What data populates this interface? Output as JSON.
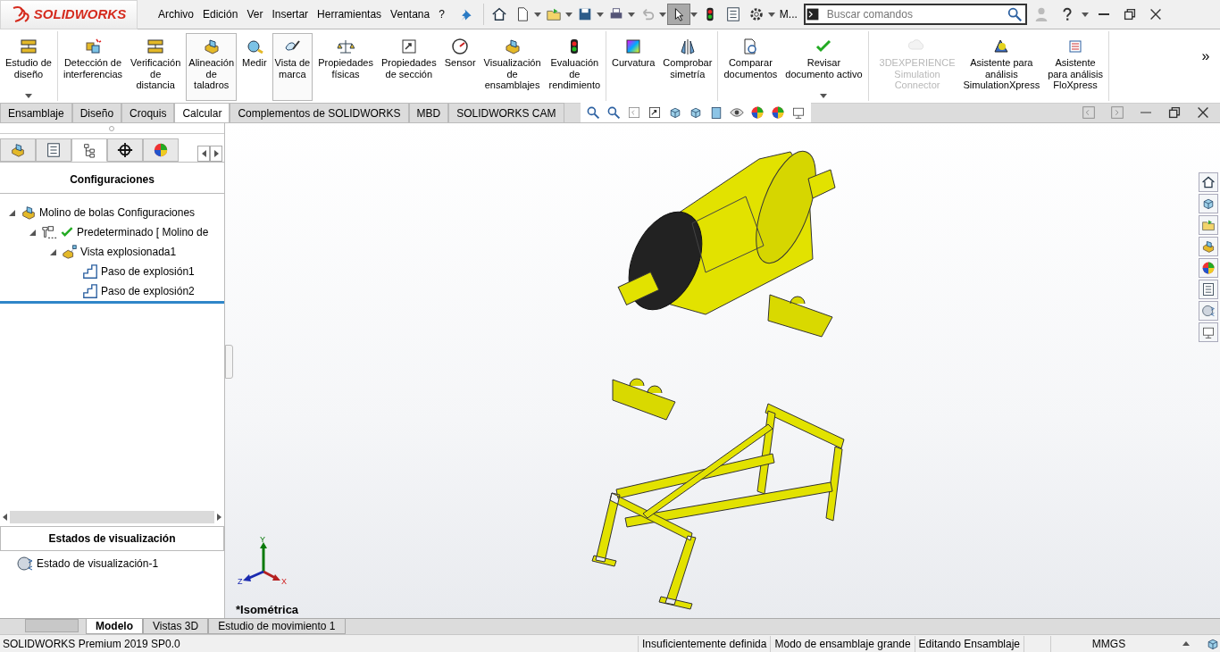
{
  "app": {
    "logo": "SOLIDWORKS"
  },
  "menu": [
    "Archivo",
    "Edición",
    "Ver",
    "Insertar",
    "Herramientas",
    "Ventana",
    "?"
  ],
  "quick_toolbar": {
    "overflow_label": "M...",
    "select_pressed": true,
    "undo_disabled": true
  },
  "search": {
    "placeholder": "Buscar comandos"
  },
  "ribbon": {
    "groups": [
      [
        {
          "label": "Estudio de\ndiseño",
          "selected": false,
          "disabled": false,
          "dropdown": true
        }
      ],
      [
        {
          "label": "Detección de\ninterferencias",
          "selected": false,
          "disabled": false,
          "dropdown": false
        },
        {
          "label": "Verificación\nde\ndistancia",
          "selected": false,
          "disabled": false,
          "dropdown": false
        },
        {
          "label": "Alineación\nde\ntaladros",
          "selected": true,
          "disabled": false,
          "dropdown": false
        },
        {
          "label": "Medir",
          "selected": false,
          "disabled": false,
          "dropdown": false
        },
        {
          "label": "Vista de\nmarca",
          "selected": true,
          "disabled": false,
          "dropdown": false
        },
        {
          "label": "Propiedades\nfísicas",
          "selected": false,
          "disabled": false,
          "dropdown": false
        },
        {
          "label": "Propiedades\nde sección",
          "selected": false,
          "disabled": false,
          "dropdown": false
        },
        {
          "label": "Sensor",
          "selected": false,
          "disabled": false,
          "dropdown": false
        },
        {
          "label": "Visualización\nde\nensamblajes",
          "selected": false,
          "disabled": false,
          "dropdown": false
        },
        {
          "label": "Evaluación\nde\nrendimiento",
          "selected": false,
          "disabled": false,
          "dropdown": false
        }
      ],
      [
        {
          "label": "Curvatura",
          "selected": false,
          "disabled": false,
          "dropdown": false
        },
        {
          "label": "Comprobar\nsimetría",
          "selected": false,
          "disabled": false,
          "dropdown": false
        }
      ],
      [
        {
          "label": "Comparar\ndocumentos",
          "selected": false,
          "disabled": false,
          "dropdown": false
        },
        {
          "label": "Revisar\ndocumento activo",
          "selected": false,
          "disabled": false,
          "dropdown": true
        }
      ],
      [
        {
          "label": "3DEXPERIENCE\nSimulation\nConnector",
          "selected": false,
          "disabled": true,
          "dropdown": false
        },
        {
          "label": "Asistente para\nanálisis\nSimulationXpress",
          "selected": false,
          "disabled": false,
          "dropdown": false
        },
        {
          "label": "Asistente\npara análisis\nFloXpress",
          "selected": false,
          "disabled": false,
          "dropdown": false
        }
      ]
    ],
    "overflow": "»"
  },
  "command_tabs": [
    {
      "label": "Ensamblaje",
      "selected": false
    },
    {
      "label": "Diseño",
      "selected": false
    },
    {
      "label": "Croquis",
      "selected": false
    },
    {
      "label": "Calcular",
      "selected": true
    },
    {
      "label": "Complementos de SOLIDWORKS",
      "selected": false
    },
    {
      "label": "MBD",
      "selected": false
    },
    {
      "label": "SOLIDWORKS CAM",
      "selected": false
    }
  ],
  "panel": {
    "tabs": [
      {
        "selected": false
      },
      {
        "selected": false
      },
      {
        "selected": true
      },
      {
        "selected": false
      },
      {
        "selected": false
      }
    ],
    "title": "Configuraciones",
    "tree": [
      {
        "label": "Molino de bolas Configuraciones",
        "kind": "assembly",
        "expanded": true,
        "active": false,
        "children": [
          {
            "label": "Predeterminado [ Molino de",
            "kind": "configuration",
            "expanded": true,
            "active": true,
            "children": [
              {
                "label": "Vista explosionada1",
                "kind": "exploded-view",
                "expanded": true,
                "active": false,
                "children": [
                  {
                    "label": "Paso de explosión1",
                    "kind": "explode-step",
                    "active": false
                  },
                  {
                    "label": "Paso de explosión2",
                    "kind": "explode-step",
                    "active": false
                  }
                ]
              }
            ]
          }
        ]
      }
    ]
  },
  "display_states": {
    "title": "Estados de visualización",
    "items": [
      "Estado de visualización-1"
    ]
  },
  "viewport": {
    "view_name": "*Isométrica",
    "axes": {
      "y": "Y",
      "x": "X",
      "z": "Z"
    }
  },
  "bottom_tabs": [
    {
      "label": "Modelo",
      "selected": true
    },
    {
      "label": "Vistas 3D",
      "selected": false
    },
    {
      "label": "Estudio de movimiento 1",
      "selected": false
    }
  ],
  "status_bar": {
    "product": "SOLIDWORKS Premium 2019 SP0.0",
    "fields": [
      "Insuficientemente definida",
      "Modo de ensamblaje grande",
      "Editando Ensamblaje"
    ],
    "units": "MMGS"
  }
}
